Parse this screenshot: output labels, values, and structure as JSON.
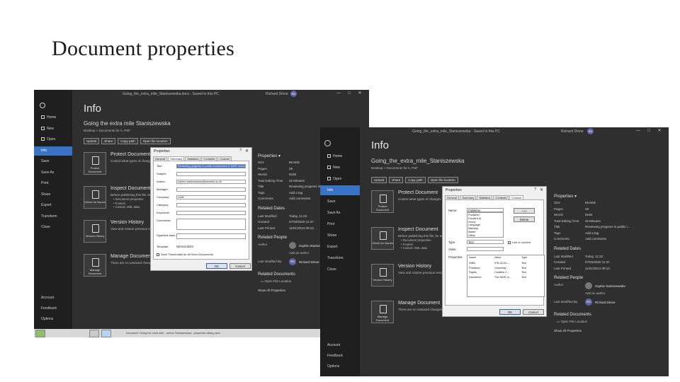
{
  "slide": {
    "title": "Document properties"
  },
  "back_window": {
    "titlebar": {
      "doc": "Going_the_extra_mile_Staniszewska.docx - Saved to this PC",
      "user": "Richard Dinne",
      "initials": "RD"
    },
    "nav": [
      "Home",
      "New",
      "Open",
      "Info",
      "Save",
      "Save As",
      "Print",
      "Share",
      "Export",
      "Transform",
      "Close",
      "Account",
      "Feedback",
      "Options"
    ],
    "info_title": "Info",
    "doc_name": "Going the extra mile Staniszewska",
    "doc_path": "Desktop » Documents for A, PSF",
    "buttons": [
      "Upload",
      "Share",
      "Copy path",
      "Open file location"
    ],
    "sections": [
      {
        "tile": "Protect Document",
        "title": "Protect Document",
        "desc": "Control what types of changes people can make",
        "bullets": []
      },
      {
        "tile": "Check for Issues",
        "title": "Inspect Document",
        "desc": "Before publishing this file, be aware",
        "bullets": [
          "Document properties",
          "Footers",
          "Custom XML data"
        ]
      },
      {
        "tile": "Version History",
        "title": "Version History",
        "desc": "View and restore previous versions",
        "bullets": []
      },
      {
        "tile": "Manage Document",
        "title": "Manage Document",
        "desc": "There are no unsaved changes.",
        "bullets": []
      }
    ],
    "properties_header": "Properties",
    "properties": [
      {
        "k": "Size",
        "v": "89.6KB"
      },
      {
        "k": "Pages",
        "v": "29"
      },
      {
        "k": "Words",
        "v": "9168"
      },
      {
        "k": "Total Editing Time",
        "v": "45 Minutes"
      },
      {
        "k": "Title",
        "v": "Reviewing progress in pub..."
      },
      {
        "k": "Tags",
        "v": "Add a tag"
      },
      {
        "k": "Comments",
        "v": "Add comments"
      }
    ],
    "related_dates_header": "Related Dates",
    "dates": [
      {
        "k": "Last Modified",
        "v": "Today, 11:23"
      },
      {
        "k": "Created",
        "v": "07/03/2020 11:37"
      },
      {
        "k": "Last Printed",
        "v": "11/01/2013 09:13"
      }
    ],
    "related_people_header": "Related People",
    "author_label": "Author",
    "author_name": "Sophie Staniszewska",
    "add_author": "Add an author",
    "last_modified_by_label": "Last Modified By",
    "last_modified_by": "Richard Dinne",
    "related_docs_header": "Related Documents",
    "open_file_location": "Open File Location",
    "show_all": "Show All Properties",
    "taskbar_text": "Document 'Going the extra mile' - author Staniszewska - properties dialog open"
  },
  "back_dialog": {
    "title": "Properties",
    "tabs": [
      "General",
      "Summary",
      "Statistics",
      "Contents",
      "Custom"
    ],
    "active_tab": "Summary",
    "fields": [
      {
        "label": "Title:",
        "value": "Reviewing progress in public involvement in NIHR research",
        "selected": true
      },
      {
        "label": "Subject:",
        "value": ""
      },
      {
        "label": "Author:",
        "value": "sophie.staniszewska@warwick.ac.uk"
      },
      {
        "label": "Manager:",
        "value": ""
      },
      {
        "label": "Company:",
        "value": "UoW"
      },
      {
        "label": "Category:",
        "value": ""
      },
      {
        "label": "Keywords:",
        "value": ""
      },
      {
        "label": "Comments:",
        "value": ""
      },
      {
        "label": "Hyperlink base:",
        "value": ""
      }
    ],
    "template_label": "Template:",
    "template_value": "Normal.dotm",
    "save_thumbnails": "Save Thumbnails for All Word Documents",
    "ok": "OK",
    "cancel": "Cancel"
  },
  "front_window": {
    "titlebar": {
      "doc": "Going_the_extra_mile_Staniszewska - Saved to this PC",
      "user": "Richard Dinne",
      "initials": "RD"
    },
    "nav": [
      "Home",
      "New",
      "Open",
      "Info",
      "Save",
      "Save As",
      "Print",
      "Share",
      "Export",
      "Transform",
      "Close",
      "Account",
      "Feedback",
      "Options"
    ],
    "info_title": "Info",
    "doc_name": "Going_the_extra_mile_Staniszewska",
    "doc_path": "Desktop » Documents for A, PSF",
    "buttons": [
      "Upload",
      "Share",
      "Copy path",
      "Open file location"
    ],
    "sections": [
      {
        "tile": "Protect Document",
        "title": "Protect Document",
        "desc": "Control what types of changes people can make",
        "bullets": []
      },
      {
        "tile": "Check for Issues",
        "title": "Inspect Document",
        "desc": "Before publishing this file, be aware",
        "bullets": [
          "Document properties",
          "Footers",
          "Custom XML data"
        ]
      },
      {
        "tile": "Version History",
        "title": "Version History",
        "desc": "View and restore previous versions",
        "bullets": []
      },
      {
        "tile": "Manage Document",
        "title": "Manage Document",
        "desc": "There are no unsaved changes.",
        "bullets": []
      }
    ],
    "properties_header": "Properties",
    "properties": [
      {
        "k": "Size",
        "v": "89.6KB"
      },
      {
        "k": "Pages",
        "v": "29"
      },
      {
        "k": "Words",
        "v": "9168"
      },
      {
        "k": "Total Editing Time",
        "v": "45 Minutes"
      },
      {
        "k": "Title",
        "v": "Reviewing progress in public i..."
      },
      {
        "k": "Tags",
        "v": "Add a tag"
      },
      {
        "k": "Comments",
        "v": "Add comments"
      }
    ],
    "related_dates_header": "Related Dates",
    "dates": [
      {
        "k": "Last Modified",
        "v": "Today, 11:23"
      },
      {
        "k": "Created",
        "v": "07/03/2020 11:37"
      },
      {
        "k": "Last Printed",
        "v": "11/01/2013 09:13"
      }
    ],
    "related_people_header": "Related People",
    "author_label": "Author",
    "author_name": "Sophie Staniszewska",
    "add_author": "Add an author",
    "last_modified_by_label": "Last Modified By",
    "last_modified_by": "Richard Dinne",
    "related_docs_header": "Related Documents",
    "open_file_location": "Open File Location",
    "show_all": "Show All Properties"
  },
  "front_dialog": {
    "title": "Properties",
    "tabs": [
      "General",
      "Summary",
      "Statistics",
      "Contents",
      "Custom"
    ],
    "active_tab": "Custom",
    "name_label": "Name:",
    "name_value": "Publisher",
    "name_list": [
      "Publisher",
      "Forward to",
      "Group",
      "Language",
      "Mailstop",
      "Matter",
      "Office"
    ],
    "add": "Add",
    "delete": "Delete",
    "type_label": "Type:",
    "type_value": "Text",
    "value_label": "Value:",
    "link_to_content": "Link to content",
    "properties_label": "Properties:",
    "columns": [
      "Name",
      "Value",
      "Type"
    ],
    "rows": [
      [
        "ISBN",
        "978-00-00-...",
        "Text"
      ],
      [
        "Publisher",
        "University ...",
        "Text"
      ],
      [
        "Rights",
        "Creative C...",
        "Text"
      ],
      [
        "Disclaimer",
        "The NIHR is...",
        "Text"
      ]
    ],
    "ok": "OK",
    "cancel": "Cancel"
  }
}
